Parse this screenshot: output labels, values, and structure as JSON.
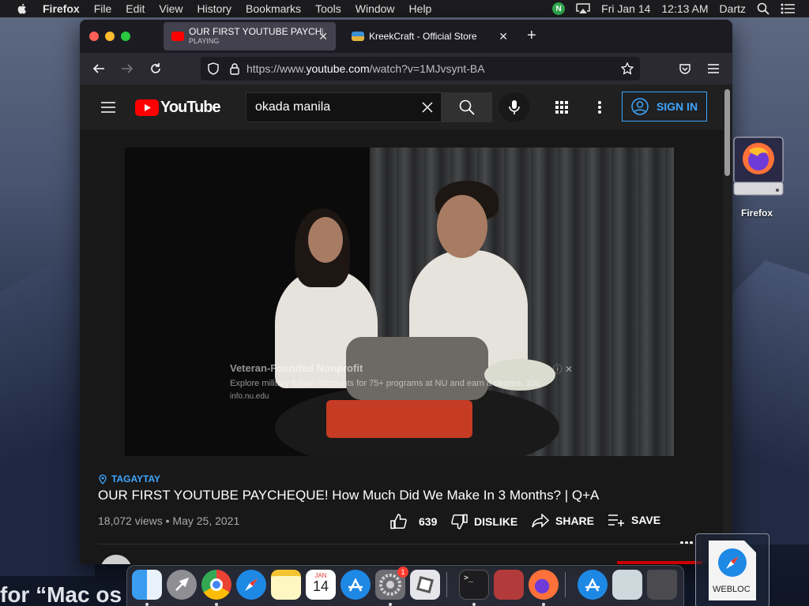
{
  "menubar": {
    "app": "Firefox",
    "items": [
      "File",
      "Edit",
      "View",
      "History",
      "Bookmarks",
      "Tools",
      "Window",
      "Help"
    ],
    "date": "Fri Jan 14",
    "time": "12:13 AM",
    "user": "Dartz"
  },
  "browser": {
    "tabs": [
      {
        "title": "OUR FIRST YOUTUBE PAYCHEQ",
        "subtitle": "PLAYING",
        "favicon_color": "#ff0000"
      },
      {
        "title": "KreekCraft - Official Store",
        "subtitle": "",
        "favicon_color": "#4aa3df"
      }
    ],
    "url_prefix": "https://www.",
    "url_domain": "youtube.com",
    "url_path": "/watch?v=1MJvsynt-BA"
  },
  "youtube": {
    "search_value": "okada manila",
    "sign_in": "SIGN IN",
    "ad": {
      "title": "Veteran-Founded Nonprofit",
      "description": "Explore military tuition discounts for 75+ programs at NU and earn a degree. 100...",
      "url": "info.nu.edu"
    },
    "location": "TAGAYTAY",
    "title": "OUR FIRST YOUTUBE PAYCHEQUE! How Much Did We Make In 3 Months? | Q+A",
    "views": "18,072 views",
    "date": "May 25, 2021",
    "likes": "639",
    "dislike": "DISLIKE",
    "share": "SHARE",
    "save": "SAVE"
  },
  "desktop": {
    "firefox_label": "Firefox",
    "webloc_label": "WEBLOC",
    "bg_text": "for “Mac os"
  },
  "dock": {
    "calendar_month": "JAN",
    "calendar_day": "14",
    "badge": "1"
  },
  "colors": {
    "yt_red": "#ff0000",
    "link_blue": "#3ea6ff",
    "firefox_orange": "#ff7139"
  }
}
